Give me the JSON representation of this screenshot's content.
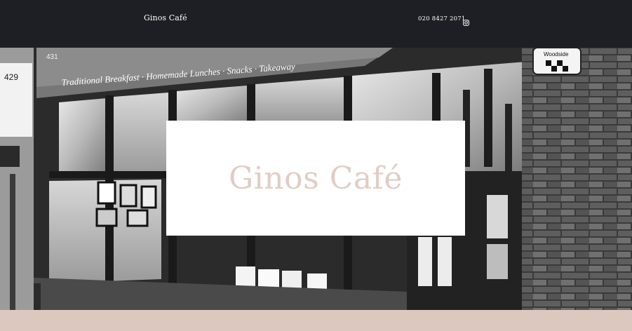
{
  "header": {
    "brand": "Ginos Café",
    "phone": "020 8427 2071",
    "social_icon": "instagram-icon"
  },
  "hero": {
    "title": "Ginos Café",
    "photo": {
      "sign_number": "431",
      "sign_tagline": "Traditional Breakfast · Homemade Lunches · Snacks · Takeaway",
      "neighbor_number": "429",
      "badge": "Woodside"
    }
  },
  "colors": {
    "header_bg": "#1e1f24",
    "accent_pink": "#e0cdc6",
    "band": "#ddc8c0",
    "white": "#ffffff"
  }
}
